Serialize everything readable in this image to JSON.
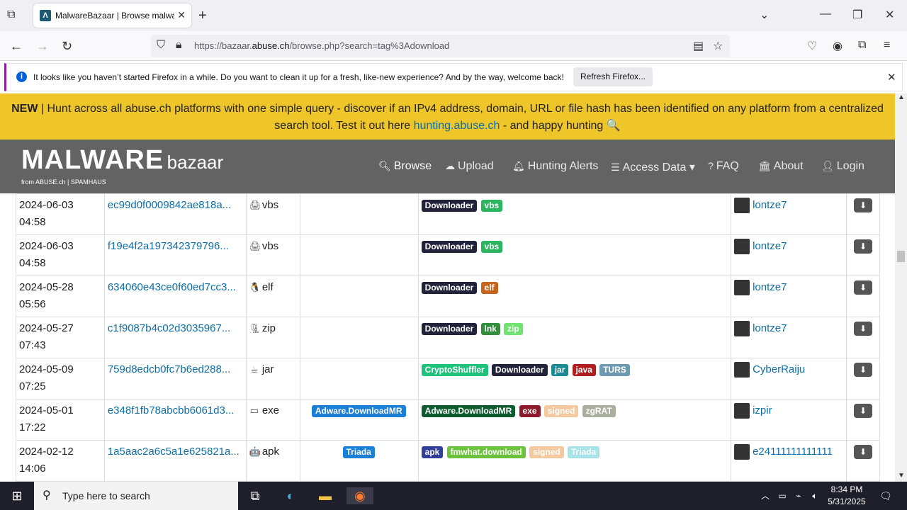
{
  "browser": {
    "tab_title": "MalwareBazaar | Browse malwa",
    "url_prefix": "https://bazaar.",
    "url_domain": "abuse.ch",
    "url_suffix": "/browse.php?search=tag%3Adownload"
  },
  "notification": {
    "message": "It looks like you haven’t started Firefox in a while. Do you want to clean it up for a fresh, like-new experience? And by the way, welcome back!",
    "button": "Refresh Firefox..."
  },
  "banner": {
    "new_label": "NEW",
    "text1": " | Hunt across all abuse.ch platforms with one simple query - discover if an IPv4 address, domain, URL or file hash has been identified on any platform from a centralized search tool. Test it out here ",
    "link": "hunting.abuse.ch",
    "text2": " - and happy hunting 🔍"
  },
  "site": {
    "logo_big": "MALWARE",
    "logo_small": "bazaar",
    "logo_sub": "from ABUSE.ch | SPAMHAUS",
    "menu": [
      {
        "label": "Browse"
      },
      {
        "label": "Upload"
      },
      {
        "label": "Hunting Alerts"
      },
      {
        "label": "Access Data ▾"
      },
      {
        "label": "FAQ"
      },
      {
        "label": "About"
      },
      {
        "label": "Login"
      }
    ]
  },
  "rows": [
    {
      "date": "2024-06-03",
      "time": "04:58",
      "hash": "ec99d0f0009842ae818a...",
      "ftype": "vbs",
      "ftype_icon": "🖨",
      "signature": "",
      "tags": [
        {
          "t": "Downloader",
          "c": "#22223b"
        },
        {
          "t": "vbs",
          "c": "#2bb55e"
        }
      ],
      "reporter": "lontze7"
    },
    {
      "date": "2024-06-03",
      "time": "04:58",
      "hash": "f19e4f2a197342379796...",
      "ftype": "vbs",
      "ftype_icon": "🖨",
      "signature": "",
      "tags": [
        {
          "t": "Downloader",
          "c": "#22223b"
        },
        {
          "t": "vbs",
          "c": "#2bb55e"
        }
      ],
      "reporter": "lontze7"
    },
    {
      "date": "2024-05-28",
      "time": "05:56",
      "hash": "634060e43ce0f60ed7cc3...",
      "ftype": "elf",
      "ftype_icon": "🐧",
      "signature": "",
      "tags": [
        {
          "t": "Downloader",
          "c": "#22223b"
        },
        {
          "t": "elf",
          "c": "#c9651b"
        }
      ],
      "reporter": "lontze7"
    },
    {
      "date": "2024-05-27",
      "time": "07:43",
      "hash": "c1f9087b4c02d3035967...",
      "ftype": "zip",
      "ftype_icon": "🗜",
      "signature": "",
      "tags": [
        {
          "t": "Downloader",
          "c": "#22223b"
        },
        {
          "t": "lnk",
          "c": "#2f8f3a"
        },
        {
          "t": "zip",
          "c": "#6fe36f"
        }
      ],
      "reporter": "lontze7"
    },
    {
      "date": "2024-05-09",
      "time": "07:25",
      "hash": "759d8edcb0fc7b6ed288...",
      "ftype": "jar",
      "ftype_icon": "☕",
      "signature": "",
      "tags": [
        {
          "t": "CryptoShuffler",
          "c": "#1fc27a"
        },
        {
          "t": "Downloader",
          "c": "#22223b"
        },
        {
          "t": "jar",
          "c": "#1a8a94"
        },
        {
          "t": "java",
          "c": "#b01f1f"
        },
        {
          "t": "TURS",
          "c": "#6f99b0"
        }
      ],
      "reporter": "CyberRaiju"
    },
    {
      "date": "2024-05-01",
      "time": "17:22",
      "hash": "e348f1fb78abcbb6061d3...",
      "ftype": "exe",
      "ftype_icon": "▭",
      "signature": "Adware.DownloadMR",
      "tags": [
        {
          "t": "Adware.DownloadMR",
          "c": "#0e5c2e"
        },
        {
          "t": "exe",
          "c": "#8c1a2a"
        },
        {
          "t": "signed",
          "c": "#f5c9a0"
        },
        {
          "t": "zgRAT",
          "c": "#a9b0a0"
        }
      ],
      "reporter": "izpir"
    },
    {
      "date": "2024-02-12",
      "time": "14:06",
      "hash": "1a5aac2a6c5a1e625821a...",
      "ftype": "apk",
      "ftype_icon": "🤖",
      "signature": "Triada",
      "tags": [
        {
          "t": "apk",
          "c": "#2f3f9a"
        },
        {
          "t": "fmwhat.download",
          "c": "#6cc23a"
        },
        {
          "t": "signed",
          "c": "#f5c9a0"
        },
        {
          "t": "Triada",
          "c": "#a6e2e8"
        }
      ],
      "reporter": "e24111111111111"
    }
  ],
  "taskbar": {
    "search_placeholder": "Type here to search",
    "time": "8:34 PM",
    "date": "5/31/2025"
  }
}
